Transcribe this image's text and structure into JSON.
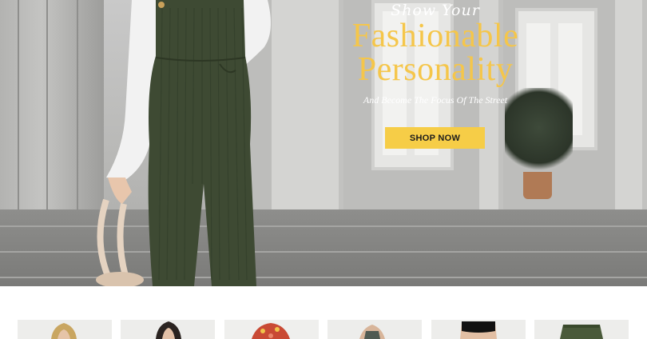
{
  "hero": {
    "script_line": "Show Your",
    "headline_1": "Fashionable",
    "headline_2": "Personality",
    "subheadline": "And Become The Focus Of The Street",
    "cta_label": "SHOP NOW",
    "accent_color": "#f5c64a",
    "button_color": "#f6cd47"
  },
  "products": [
    {
      "name": "product-thumb-1",
      "icon": "blonde-model-top"
    },
    {
      "name": "product-thumb-2",
      "icon": "dark-hair-model-top"
    },
    {
      "name": "product-thumb-3",
      "icon": "floral-print-top"
    },
    {
      "name": "product-thumb-4",
      "icon": "tank-top-model"
    },
    {
      "name": "product-thumb-5",
      "icon": "black-crop-top"
    },
    {
      "name": "product-thumb-6",
      "icon": "green-shorts"
    }
  ]
}
